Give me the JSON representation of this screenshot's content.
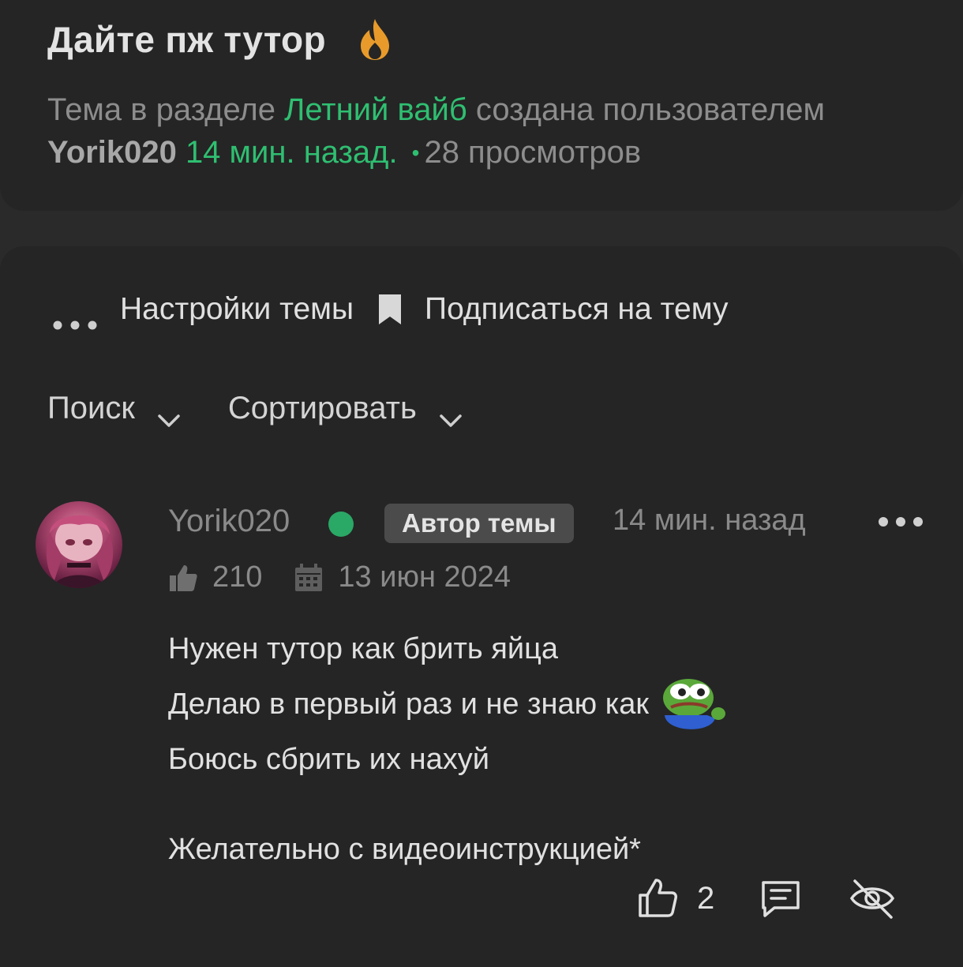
{
  "thread": {
    "title": "Дайте пж тутор",
    "meta_prefix": "Тема в разделе ",
    "section": "Летний вайб",
    "meta_mid": " создана пользователем",
    "author": "Yorik020",
    "created": "14 мин. назад.",
    "views": "28 просмотров"
  },
  "actions": {
    "settings": "Настройки темы",
    "subscribe": "Подписаться на тему"
  },
  "filters": {
    "search": "Поиск",
    "sort": "Сортировать"
  },
  "post": {
    "username": "Yorik020",
    "badge": "Автор темы",
    "time": "14 мин. назад",
    "likes_total": "210",
    "registered": "13 июн 2024",
    "lines": [
      "Нужен тутор как брить яйца",
      "Делаю в первый раз и не знаю как",
      "Боюсь сбрить их нахуй",
      "Желательно с видеоинструкцией*"
    ],
    "like_count": "2"
  },
  "colors": {
    "accent_green": "#2fbf71",
    "background": "#2a2a2a",
    "card": "#252525"
  },
  "icons": [
    "fire-icon",
    "more-dots-icon",
    "bookmark-icon",
    "chevron-down-icon",
    "thumbs-up-icon",
    "calendar-icon",
    "pepe-emoji",
    "like-icon",
    "reply-icon",
    "hide-icon"
  ]
}
